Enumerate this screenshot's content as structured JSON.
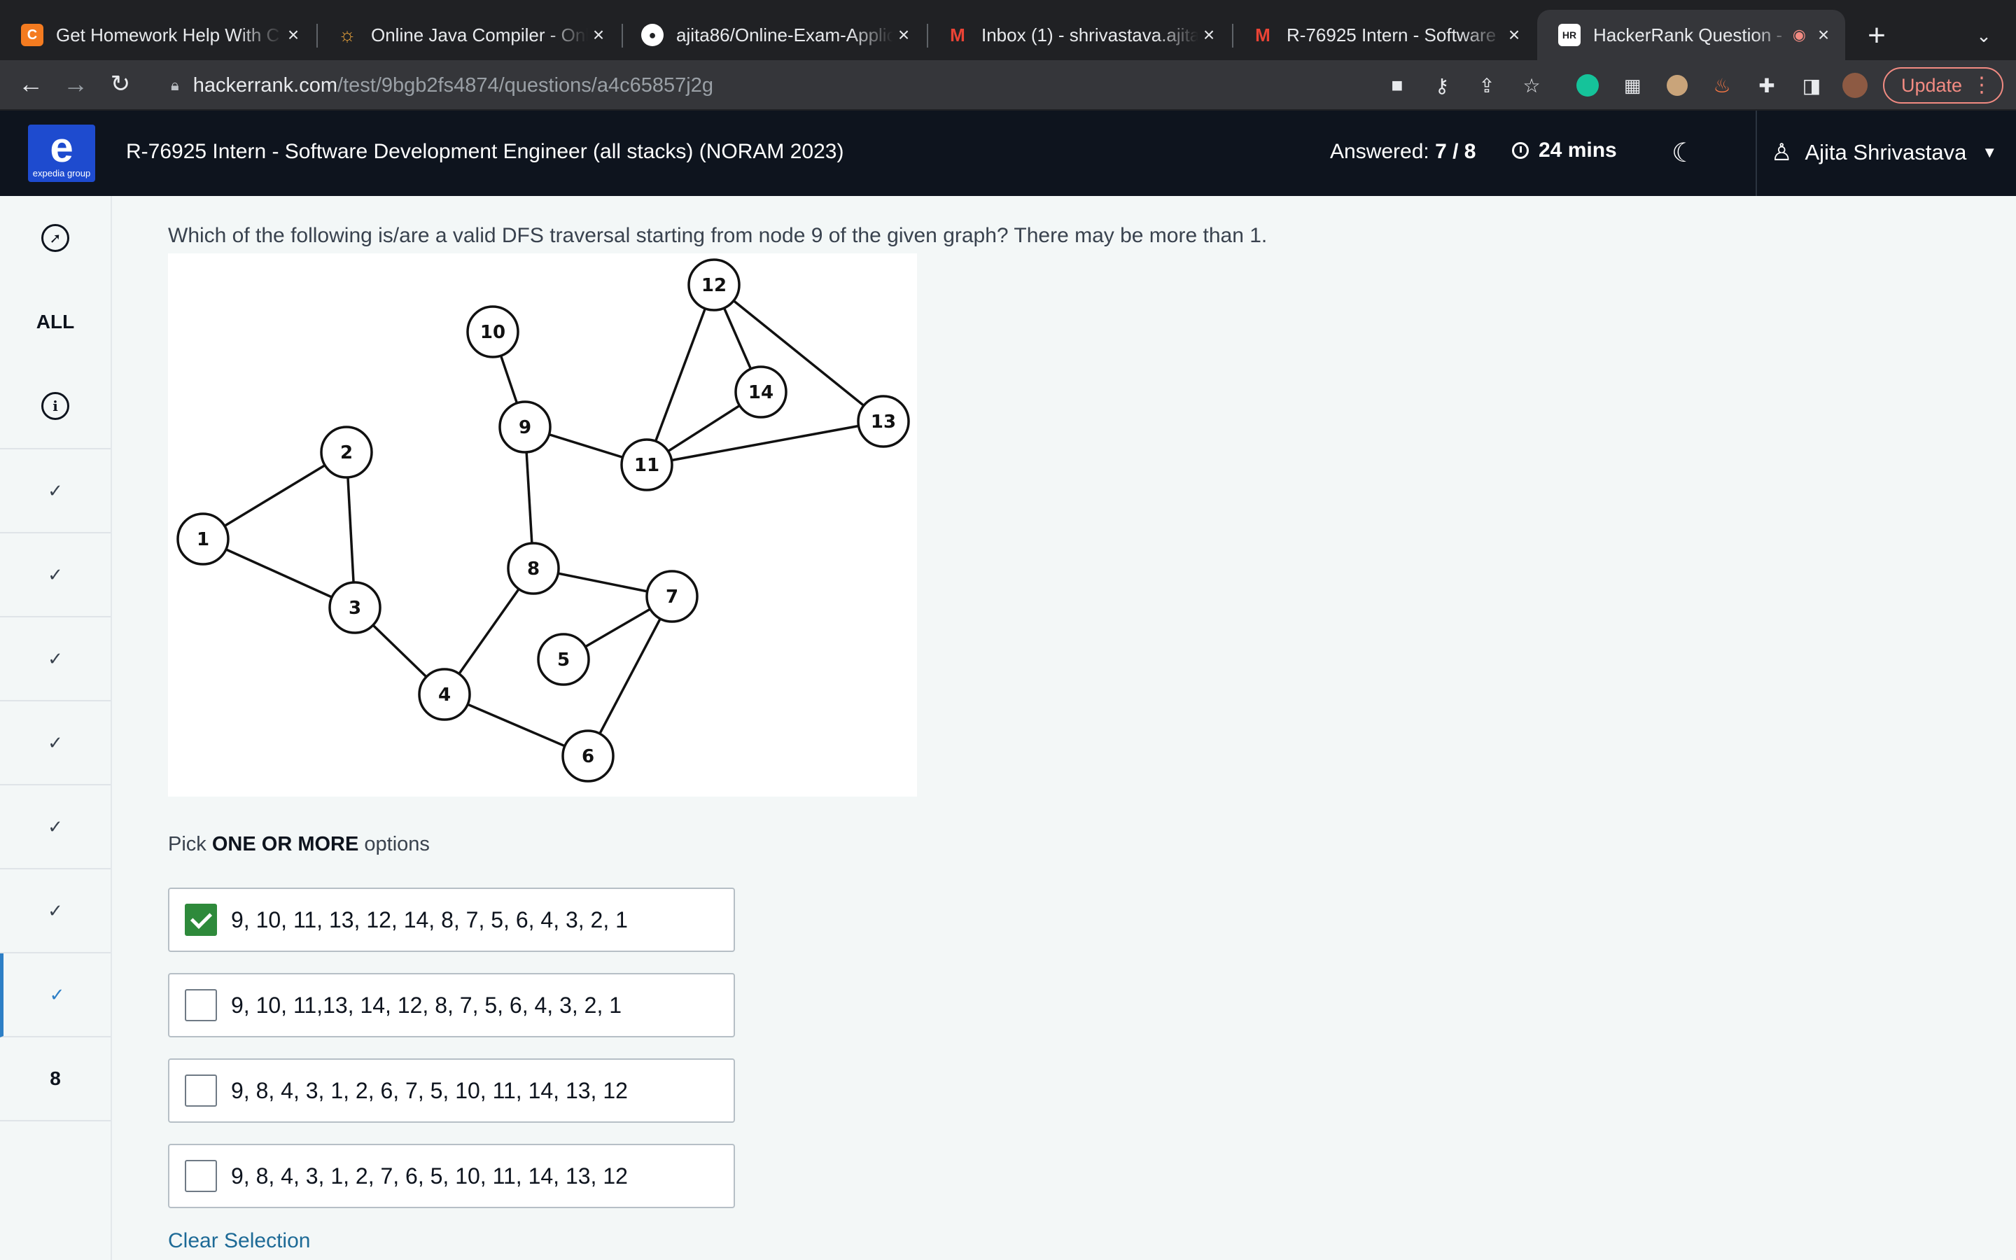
{
  "browser": {
    "tabs": [
      {
        "title": "Get Homework Help With C",
        "favicon": "C",
        "favicon_color": "#f47b20"
      },
      {
        "title": "Online Java Compiler - Onli",
        "favicon": "sun-icon",
        "favicon_color": "#e8a23a"
      },
      {
        "title": "ajita86/Online-Exam-Applic",
        "favicon": "github-icon",
        "favicon_color": "#ffffff"
      },
      {
        "title": "Inbox (1) - shrivastava.ajita",
        "favicon": "M",
        "favicon_color": "#ea4335"
      },
      {
        "title": "R-76925 Intern - Software",
        "favicon": "M",
        "favicon_color": "#ea4335"
      },
      {
        "title": "HackerRank Question -",
        "favicon": "HR",
        "favicon_color": "#ffffff"
      }
    ],
    "url_host": "hackerrank.com",
    "url_path": "/test/9bgb2fs4874/questions/a4c65857j2g",
    "update_label": "Update"
  },
  "header": {
    "logo_letter": "e",
    "logo_sub": "expedia group",
    "test_title": "R-76925 Intern - Software Development Engineer (all stacks) (NORAM 2023)",
    "answered_label": "Answered:",
    "answered_value": "7 / 8",
    "timer": "24 mins",
    "user_name": "Ajita Shrivastava"
  },
  "sidebar": {
    "all_label": "ALL",
    "current_number": "8"
  },
  "question": {
    "text": "Which of the following is/are a valid DFS traversal starting from node 9 of the given graph? There may be more than 1.",
    "graph": {
      "nodes": [
        "1",
        "2",
        "3",
        "4",
        "5",
        "6",
        "7",
        "8",
        "9",
        "10",
        "11",
        "12",
        "13",
        "14"
      ],
      "edges": [
        [
          "1",
          "2"
        ],
        [
          "1",
          "3"
        ],
        [
          "2",
          "3"
        ],
        [
          "3",
          "4"
        ],
        [
          "4",
          "8"
        ],
        [
          "4",
          "6"
        ],
        [
          "6",
          "7"
        ],
        [
          "7",
          "5"
        ],
        [
          "7",
          "8"
        ],
        [
          "8",
          "9"
        ],
        [
          "9",
          "10"
        ],
        [
          "9",
          "11"
        ],
        [
          "11",
          "12"
        ],
        [
          "11",
          "14"
        ],
        [
          "11",
          "13"
        ],
        [
          "12",
          "14"
        ],
        [
          "12",
          "13"
        ]
      ]
    },
    "pick_prefix": "Pick",
    "pick_bold": "ONE OR MORE",
    "pick_suffix": "options",
    "options": [
      {
        "text": "9, 10, 11, 13, 12, 14, 8, 7, 5, 6, 4, 3, 2, 1",
        "checked": true
      },
      {
        "text": "9, 10, 11,13, 14, 12, 8, 7, 5, 6, 4, 3, 2, 1",
        "checked": false
      },
      {
        "text": "9, 8, 4, 3, 1, 2, 6, 7, 5, 10, 11, 14, 13, 12",
        "checked": false
      },
      {
        "text": "9, 8, 4, 3, 1, 2, 7, 6, 5, 10, 11, 14, 13, 12",
        "checked": false
      }
    ],
    "clear_label": "Clear Selection"
  }
}
